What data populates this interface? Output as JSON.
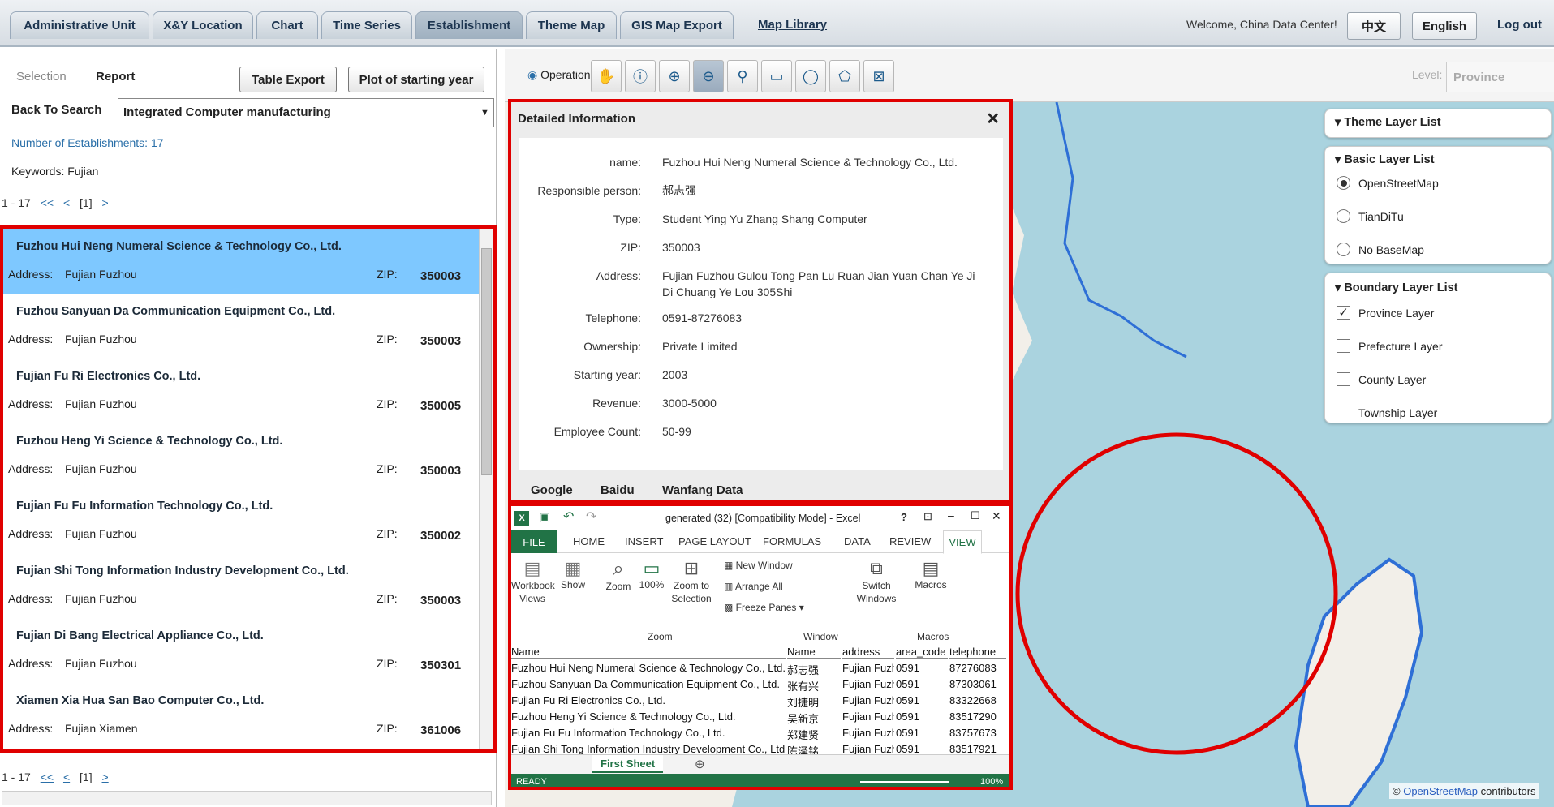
{
  "tabs": [
    {
      "label": "Administrative Unit",
      "active": false
    },
    {
      "label": "X&Y Location",
      "active": false
    },
    {
      "label": "Chart",
      "active": false
    },
    {
      "label": "Time Series",
      "active": false
    },
    {
      "label": "Establishment",
      "active": true
    },
    {
      "label": "Theme Map",
      "active": false
    },
    {
      "label": "GIS Map Export",
      "active": false
    }
  ],
  "header": {
    "map_library": "Map Library",
    "welcome": "Welcome, China Data Center!",
    "lang_cn": "中文",
    "lang_en": "English",
    "logout": "Log out"
  },
  "left": {
    "tab_selection": "Selection",
    "tab_report": "Report",
    "table_export": "Table Export",
    "plot_year": "Plot of starting year",
    "back_to_search": "Back To Search",
    "industry_value": "Integrated Computer manufacturing",
    "num_establishments": "Number of Establishments: 17",
    "keywords": "Keywords: Fujian",
    "pager": {
      "range": "1 - 17",
      "first": "<<",
      "prev": "<",
      "page": "[1]",
      "next": ">"
    }
  },
  "establishments": [
    {
      "name": "Fuzhou Hui Neng Numeral Science & Technology Co., Ltd.",
      "address_label": "Address:",
      "address": "Fujian Fuzhou",
      "zip_label": "ZIP:",
      "zip": "350003",
      "selected": true
    },
    {
      "name": "Fuzhou Sanyuan Da Communication Equipment Co., Ltd.",
      "address_label": "Address:",
      "address": "Fujian Fuzhou",
      "zip_label": "ZIP:",
      "zip": "350003",
      "selected": false
    },
    {
      "name": "Fujian Fu Ri Electronics Co., Ltd.",
      "address_label": "Address:",
      "address": "Fujian Fuzhou",
      "zip_label": "ZIP:",
      "zip": "350005",
      "selected": false
    },
    {
      "name": "Fuzhou Heng Yi Science & Technology Co., Ltd.",
      "address_label": "Address:",
      "address": "Fujian Fuzhou",
      "zip_label": "ZIP:",
      "zip": "350003",
      "selected": false
    },
    {
      "name": "Fujian Fu Fu Information Technology Co., Ltd.",
      "address_label": "Address:",
      "address": "Fujian Fuzhou",
      "zip_label": "ZIP:",
      "zip": "350002",
      "selected": false
    },
    {
      "name": "Fujian Shi Tong Information Industry Development Co., Ltd.",
      "address_label": "Address:",
      "address": "Fujian Fuzhou",
      "zip_label": "ZIP:",
      "zip": "350003",
      "selected": false
    },
    {
      "name": "Fujian Di Bang Electrical Appliance Co., Ltd.",
      "address_label": "Address:",
      "address": "Fujian Fuzhou",
      "zip_label": "ZIP:",
      "zip": "350301",
      "selected": false
    },
    {
      "name": "Xiamen Xia Hua San Bao Computer Co., Ltd.",
      "address_label": "Address:",
      "address": "Fujian Xiamen",
      "zip_label": "ZIP:",
      "zip": "361006",
      "selected": false
    }
  ],
  "map_toolbar": {
    "operations": "Operations",
    "level_label": "Level:",
    "level_value": "Province",
    "tools": [
      "pan-icon",
      "info-icon",
      "zoom-in-icon",
      "zoom-out-icon",
      "point-select-icon",
      "rectangle-select-icon",
      "circle-select-icon",
      "polygon-select-icon",
      "clear-select-icon"
    ]
  },
  "detail": {
    "title": "Detailed Information",
    "close": "✕",
    "fields": [
      {
        "label": "name:",
        "value": "Fuzhou Hui Neng Numeral Science & Technology Co., Ltd."
      },
      {
        "label": "Responsible person:",
        "value": "郝志强"
      },
      {
        "label": "Type:",
        "value": "Student Ying Yu Zhang Shang Computer"
      },
      {
        "label": "ZIP:",
        "value": "350003"
      },
      {
        "label": "Address:",
        "value": "Fujian Fuzhou Gulou Tong Pan Lu Ruan Jian Yuan Chan Ye Ji Di Chuang Ye Lou 305Shi"
      },
      {
        "label": "Telephone:",
        "value": "0591-87276083"
      },
      {
        "label": "Ownership:",
        "value": "Private Limited"
      },
      {
        "label": "Starting year:",
        "value": "2003"
      },
      {
        "label": "Revenue:",
        "value": "3000-5000"
      },
      {
        "label": "Employee Count:",
        "value": "50-99"
      }
    ],
    "links": [
      "Google",
      "Baidu",
      "Wanfang Data"
    ]
  },
  "layers": {
    "theme_title": "Theme Layer List",
    "basic_title": "Basic Layer List",
    "basic": [
      {
        "label": "OpenStreetMap",
        "checked": true
      },
      {
        "label": "TianDiTu",
        "checked": false
      },
      {
        "label": "No BaseMap",
        "checked": false
      }
    ],
    "boundary_title": "Boundary Layer List",
    "boundary": [
      {
        "label": "Province Layer",
        "checked": true
      },
      {
        "label": "Prefecture Layer",
        "checked": false
      },
      {
        "label": "County Layer",
        "checked": false
      },
      {
        "label": "Township Layer",
        "checked": false
      }
    ]
  },
  "excel": {
    "title": "generated (32)  [Compatibility Mode] - Excel",
    "ribbon_tabs": [
      "FILE",
      "HOME",
      "INSERT",
      "PAGE LAYOUT",
      "FORMULAS",
      "DATA",
      "REVIEW",
      "VIEW"
    ],
    "tools": {
      "workbook_views": "Workbook Views",
      "show": "Show",
      "zoom": "Zoom",
      "zoom100": "100%",
      "zoom_selection": "Zoom to Selection",
      "new_window": "New Window",
      "arrange_all": "Arrange All",
      "freeze_panes": "Freeze Panes",
      "switch_windows": "Switch Windows",
      "macros": "Macros",
      "group_zoom": "Zoom",
      "group_window": "Window",
      "group_macros": "Macros"
    },
    "headers": [
      "Name",
      "Name",
      "address",
      "area_code",
      "telephone"
    ],
    "rows": [
      [
        "Fuzhou Hui Neng Numeral Science & Technology Co., Ltd.",
        "郝志强",
        "Fujian Fuzhou",
        "0591",
        "87276083"
      ],
      [
        "Fuzhou Sanyuan Da Communication Equipment Co., Ltd.",
        "张有兴",
        "Fujian Fuzhou",
        "0591",
        "87303061"
      ],
      [
        "Fujian Fu Ri Electronics Co., Ltd.",
        "刘捷明",
        "Fujian Fuzhou",
        "0591",
        "83322668"
      ],
      [
        "Fuzhou Heng Yi Science & Technology Co., Ltd.",
        "吴新京",
        "Fujian Fuzhou",
        "0591",
        "83517290"
      ],
      [
        "Fujian Fu Fu Information Technology Co., Ltd.",
        "郑建贤",
        "Fujian Fuzhou",
        "0591",
        "83757673"
      ],
      [
        "Fujian Shi Tong Information Industry Development Co., Ltd.",
        "陈泽铭",
        "Fujian Fuzhou",
        "0591",
        "83517921"
      ]
    ],
    "sheet_tab": "First Sheet",
    "status": "READY",
    "zoom_pct": "100%"
  },
  "attribution": {
    "prefix": "©",
    "link": "OpenStreetMap",
    "suffix": "contributors"
  },
  "colors": {
    "highlight": "#e00000",
    "selected_row": "#7ec8ff",
    "excel_green": "#217346",
    "dot_fill": "#b0457f",
    "dot_stroke": "#4caf50"
  }
}
